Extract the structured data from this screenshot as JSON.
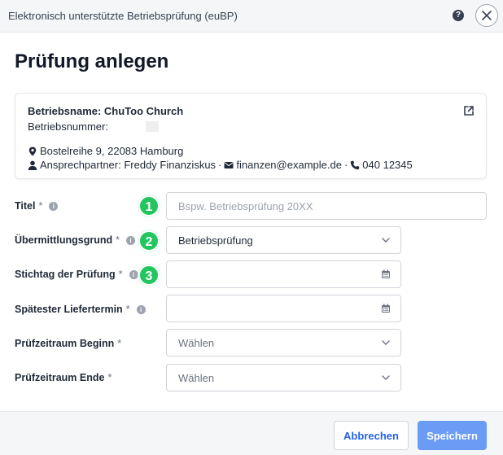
{
  "window": {
    "title": "Elektronisch unterstützte Betriebsprüfung (euBP)",
    "help_icon": "?"
  },
  "page": {
    "title": "Prüfung anlegen"
  },
  "company": {
    "name_label": "Betriebsname: ChuToo Church",
    "number_label": "Betriebsnummer:",
    "address": "Bostelreihe 9, 22083 Hamburg",
    "contact_person": "Ansprechpartner: Freddy Finanziskus",
    "email": "finanzen@example.de",
    "phone": "040 12345",
    "separator": "·"
  },
  "form": {
    "required_marker": "*",
    "info_glyph": "i",
    "title": {
      "label": "Titel",
      "placeholder": "Bspw. Betriebsprüfung 20XX",
      "value": "",
      "step": "1"
    },
    "reason": {
      "label": "Übermittlungsgrund",
      "value": "Betriebsprüfung",
      "step": "2"
    },
    "key_date": {
      "label": "Stichtag der Prüfung",
      "value": "",
      "step": "3"
    },
    "latest_delivery": {
      "label": "Spätester Liefertermin",
      "value": ""
    },
    "period_start": {
      "label": "Prüfzeitraum Beginn",
      "placeholder": "Wählen"
    },
    "period_end": {
      "label": "Prüfzeitraum Ende",
      "placeholder": "Wählen"
    }
  },
  "footer": {
    "cancel_label": "Abbrechen",
    "save_label": "Speichern"
  },
  "colors": {
    "accent": "#2563eb",
    "save_button": "#6b9cf5",
    "step_badge": "#22c55e"
  },
  "icons": {
    "help": "help-icon",
    "close": "close-icon",
    "external": "external-link-icon",
    "location": "map-marker-icon",
    "person": "user-icon",
    "mail": "envelope-icon",
    "phone": "phone-icon",
    "calendar": "calendar-icon",
    "dropdown": "chevron-down-icon"
  }
}
